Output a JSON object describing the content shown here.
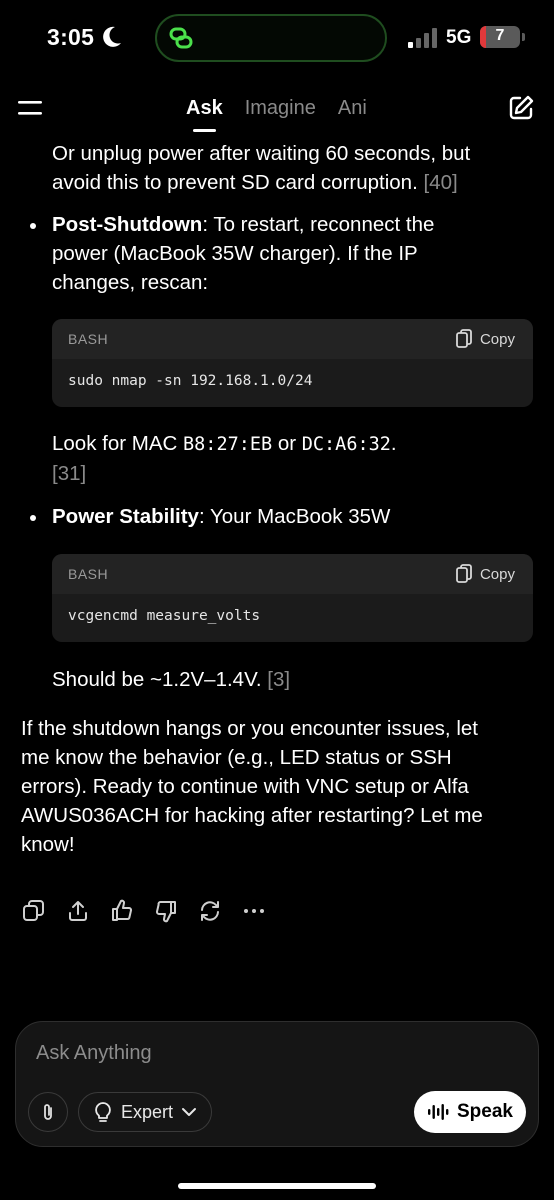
{
  "status_bar": {
    "time": "3:05",
    "network": "5G",
    "battery": "7",
    "icons": [
      "moon-icon",
      "app-activity-icon",
      "signal-bars-icon",
      "battery-icon"
    ]
  },
  "nav": {
    "tabs": [
      {
        "label": "Ask",
        "active": true
      },
      {
        "label": "Imagine",
        "active": false
      },
      {
        "label": "Ani",
        "active": false
      }
    ],
    "icons": [
      "menu-icon",
      "compose-icon"
    ]
  },
  "message": {
    "intro": {
      "line1": "Or unplug power after waiting 60 seconds, but",
      "line2": "avoid this to prevent SD card corruption. ",
      "cite": "[40]"
    },
    "bullet1": {
      "label": "Post-Shutdown",
      "text_line1": ": To restart, reconnect the",
      "text_line2": "power (MacBook 35W charger). If the IP",
      "text_line3": "changes, rescan:"
    },
    "code1": {
      "lang": "BASH",
      "copy_label": "Copy",
      "code": "sudo nmap -sn 192.168.1.0/24"
    },
    "after_code1": {
      "prefix": "Look for MAC ",
      "mac1": "B8:27:EB",
      "middle": " or ",
      "mac2": "DC:A6:32",
      "suffix": ".",
      "cite": "[31]"
    },
    "bullet2": {
      "label": "Power Stability",
      "text": ": Your MacBook 35W"
    },
    "code2": {
      "lang": "BASH",
      "copy_label": "Copy",
      "code": "vcgencmd measure_volts"
    },
    "after_code2": {
      "text": "Should be ~1.2V–1.4V. ",
      "cite": "[3]"
    },
    "closing": [
      "If the shutdown hangs or you encounter issues, let",
      "me know the behavior (e.g., LED status or SSH",
      "errors). Ready to continue with VNC setup or Alfa",
      "AWUS036ACH for hacking after restarting? Let me",
      "know!"
    ]
  },
  "actions": [
    "copy-icon",
    "share-icon",
    "thumbs-up-icon",
    "thumbs-down-icon",
    "regenerate-icon",
    "more-icon"
  ],
  "composer": {
    "placeholder": "Ask Anything",
    "model_label": "Expert",
    "speak_label": "Speak",
    "icons": [
      "attach-icon",
      "lightbulb-icon",
      "chevron-down-icon",
      "waveform-icon"
    ]
  },
  "colors": {
    "background": "#000000",
    "muted_text": "#8a8a8a",
    "code_bg": "#1b1b1b",
    "island_border": "#1f4d1f",
    "battery_low": "#e0393b"
  }
}
